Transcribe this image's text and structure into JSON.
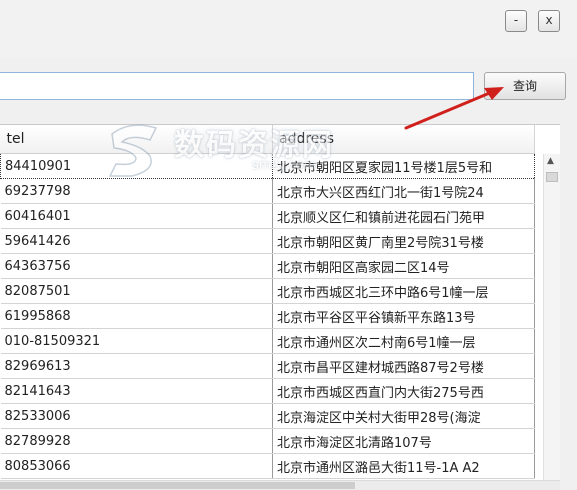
{
  "window": {
    "minimize_label": "-",
    "close_label": "x"
  },
  "search": {
    "value": "",
    "placeholder": "",
    "button_label": "查询"
  },
  "table": {
    "columns": [
      "tel",
      "address"
    ],
    "rows": [
      {
        "tel": "84410901",
        "address": "北京市朝阳区夏家园11号楼1层5号和"
      },
      {
        "tel": "69237798",
        "address": "北京市大兴区西红门北一街1号院24"
      },
      {
        "tel": "60416401",
        "address": "北京顺义区仁和镇前进花园石门苑甲"
      },
      {
        "tel": "59641426",
        "address": "北京市朝阳区黄厂南里2号院31号楼"
      },
      {
        "tel": "64363756",
        "address": "北京市朝阳区高家园二区14号"
      },
      {
        "tel": "82087501",
        "address": "北京市西城区北三环中路6号1幢一层"
      },
      {
        "tel": "61995868",
        "address": "北京市平谷区平谷镇新平东路13号"
      },
      {
        "tel": "010-81509321",
        "address": "北京市通州区次二村南6号1幢一层"
      },
      {
        "tel": "82969613",
        "address": "北京市昌平区建材城西路87号2号楼"
      },
      {
        "tel": "82141643",
        "address": "北京市西城区西直门内大街275号西"
      },
      {
        "tel": "82533006",
        "address": "北京海淀区中关村大街甲28号(海淀"
      },
      {
        "tel": "82789928",
        "address": "北京市海淀区北清路107号"
      },
      {
        "tel": "80853066",
        "address": "北京市通州区潞邑大街11号-1A A2"
      }
    ]
  },
  "watermark": {
    "text": "数码资源网",
    "url": "smzy.com"
  },
  "colors": {
    "arrow": "#d0201c"
  }
}
